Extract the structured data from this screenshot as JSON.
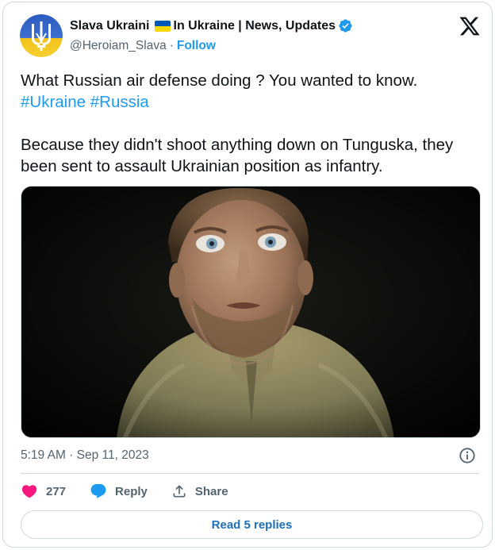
{
  "author": {
    "name": "Slava Ukraini",
    "name_suffix": "In Ukraine | News, Updates",
    "handle": "@Heroiam_Slava",
    "separator": "·",
    "follow_label": "Follow",
    "verified_color": "#1d9bf0"
  },
  "tweet": {
    "line1": "What Russian air defense doing ? You wanted to know.",
    "hashtags": [
      "#Ukraine",
      "#Russia"
    ],
    "line2": "Because they didn't shoot anything down on Tunguska, they been sent to assault Ukrainian position as infantry.",
    "timestamp": "5:19 AM · Sep 11, 2023"
  },
  "actions": {
    "like_count": "277",
    "reply_label": "Reply",
    "share_label": "Share"
  },
  "read_replies_label": "Read 5 replies",
  "colors": {
    "accent": "#1d9bf0",
    "like": "#f91880",
    "ukraine_blue": "#0057b7",
    "ukraine_yellow": "#ffd700"
  },
  "icons": {
    "logo": "x-logo-icon",
    "info": "info-icon",
    "like": "heart-icon",
    "reply": "speech-bubble-icon",
    "share": "share-icon"
  }
}
